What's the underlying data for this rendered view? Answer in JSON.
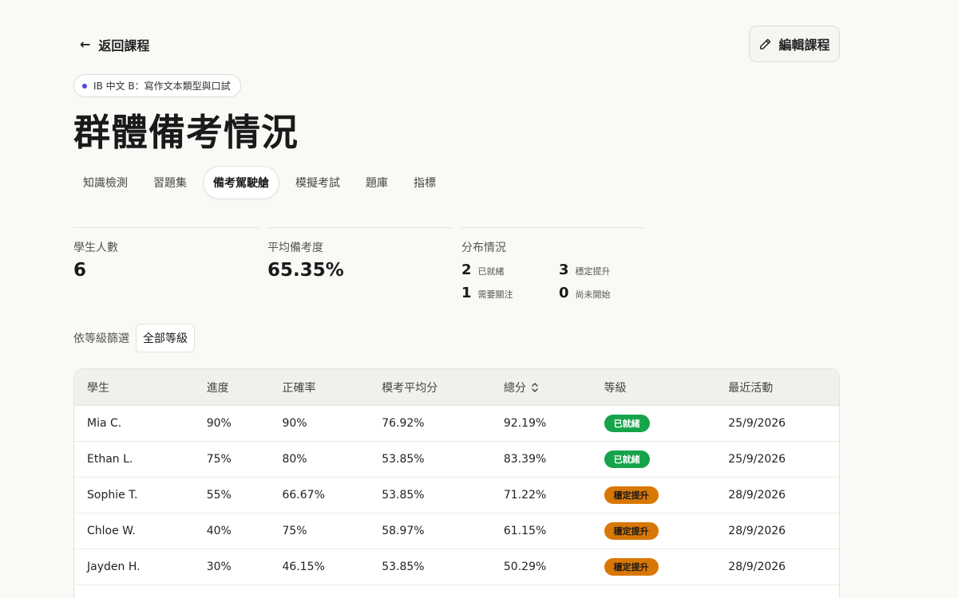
{
  "header": {
    "back_label": "返回課程",
    "edit_label": "編輯課程"
  },
  "course_pill": "IB 中文 B：寫作文本類型與口試",
  "page_title": "群體備考情況",
  "tabs": [
    {
      "label": "知識檢測",
      "active": false
    },
    {
      "label": "習題集",
      "active": false
    },
    {
      "label": "備考駕駛艙",
      "active": true
    },
    {
      "label": "模擬考試",
      "active": false
    },
    {
      "label": "題庫",
      "active": false
    },
    {
      "label": "指標",
      "active": false
    }
  ],
  "stats": {
    "students_label": "學生人數",
    "students_value": "6",
    "avg_label": "平均備考度",
    "avg_value": "65.35%",
    "dist_label": "分布情況",
    "dist": [
      {
        "num": "2",
        "label": "已就緒"
      },
      {
        "num": "3",
        "label": "穩定提升"
      },
      {
        "num": "1",
        "label": "需要關注"
      },
      {
        "num": "0",
        "label": "尚未開始"
      }
    ]
  },
  "filter": {
    "label": "依等級篩選",
    "value": "全部等級"
  },
  "table": {
    "headers": [
      "學生",
      "進度",
      "正確率",
      "模考平均分",
      "總分",
      "等級",
      "最近活動"
    ],
    "rows": [
      {
        "student": "Mia C.",
        "progress": "90%",
        "accuracy": "90%",
        "mock": "76.92%",
        "total": "92.19%",
        "level": "已就緒",
        "level_type": "ready",
        "last": "25/9/2026"
      },
      {
        "student": "Ethan L.",
        "progress": "75%",
        "accuracy": "80%",
        "mock": "53.85%",
        "total": "83.39%",
        "level": "已就緒",
        "level_type": "ready",
        "last": "25/9/2026"
      },
      {
        "student": "Sophie T.",
        "progress": "55%",
        "accuracy": "66.67%",
        "mock": "53.85%",
        "total": "71.22%",
        "level": "穩定提升",
        "level_type": "steady",
        "last": "28/9/2026"
      },
      {
        "student": "Chloe W.",
        "progress": "40%",
        "accuracy": "75%",
        "mock": "58.97%",
        "total": "61.15%",
        "level": "穩定提升",
        "level_type": "steady",
        "last": "28/9/2026"
      },
      {
        "student": "Jayden H.",
        "progress": "30%",
        "accuracy": "46.15%",
        "mock": "53.85%",
        "total": "50.29%",
        "level": "穩定提升",
        "level_type": "steady",
        "last": "28/9/2026"
      }
    ]
  },
  "colors": {
    "ready": "#16a34a",
    "steady": "#d97706",
    "attention": "#e11d48",
    "accent_dot": "#4f46e5"
  }
}
